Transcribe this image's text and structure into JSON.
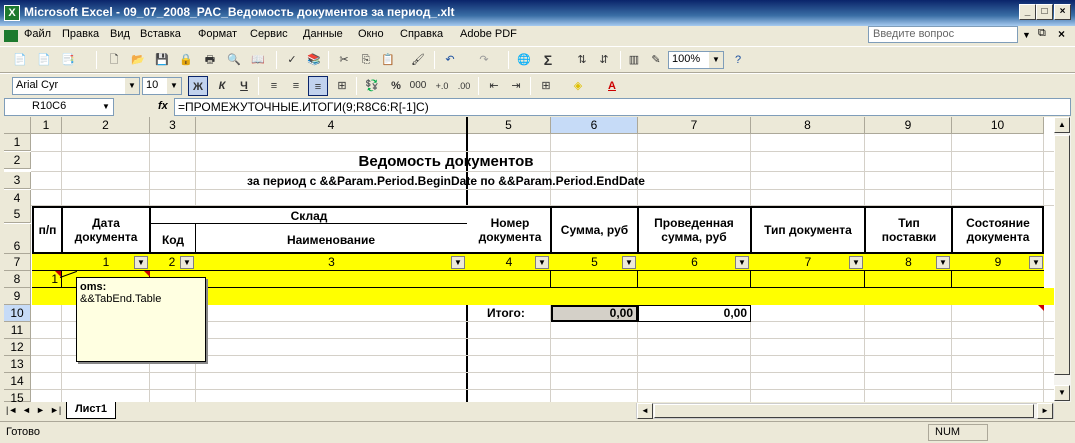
{
  "window": {
    "title": "Microsoft Excel - 09_07_2008_PAC_Ведомость документов за период_.xlt",
    "app_icon": "X"
  },
  "menu": {
    "items": [
      "Файл",
      "Правка",
      "Вид",
      "Вставка",
      "Формат",
      "Сервис",
      "Данные",
      "Окно",
      "Справка",
      "Adobe PDF"
    ],
    "help_placeholder": "Введите вопрос"
  },
  "toolbar": {
    "zoom": "100%",
    "font_name": "Arial Cyr",
    "font_size": "10",
    "bold": "Ж",
    "italic": "К",
    "underline": "Ч",
    "percent": "%",
    "thousands": "000"
  },
  "formula_bar": {
    "name_box": "R10C6",
    "fx": "fx",
    "formula": "=ПРОМЕЖУТОЧНЫЕ.ИТОГИ(9;R8C6:R[-1]C)"
  },
  "columns": [
    "1",
    "2",
    "3",
    "4",
    "5",
    "6",
    "7",
    "8",
    "9",
    "10"
  ],
  "rows": [
    "1",
    "2",
    "3",
    "4",
    "5",
    "6",
    "7",
    "8",
    "9",
    "10",
    "11",
    "12",
    "13",
    "14",
    "15"
  ],
  "report": {
    "title": "Ведомость документов",
    "subtitle": "за период с &&Param.Period.BeginDate по &&Param.Period.EndDate",
    "headers": {
      "pp": "п/п",
      "date": "Дата документа",
      "warehouse": "Склад",
      "code": "Код",
      "name": "Наименование",
      "doc_number": "Номер документа",
      "sum": "Сумма, руб",
      "posted_sum": "Проведенная сумма, руб",
      "doc_type": "Тип документа",
      "delivery_type": "Тип поставки",
      "doc_state": "Состояние документа"
    },
    "filter_row": [
      "1",
      "2",
      "3",
      "4",
      "5",
      "6",
      "7",
      "8",
      "9"
    ],
    "row8_value": "1",
    "total_label": "Итого:",
    "total_sum": "0,00",
    "total_posted": "0,00"
  },
  "comment": {
    "author": "oms:",
    "text": "&&TabEnd.Table"
  },
  "sheet_tab": "Лист1",
  "status": {
    "left": "Готово",
    "num": "NUM"
  },
  "colors": {
    "yellow": "#ffff00",
    "selected_col": "#c6dbf7"
  }
}
